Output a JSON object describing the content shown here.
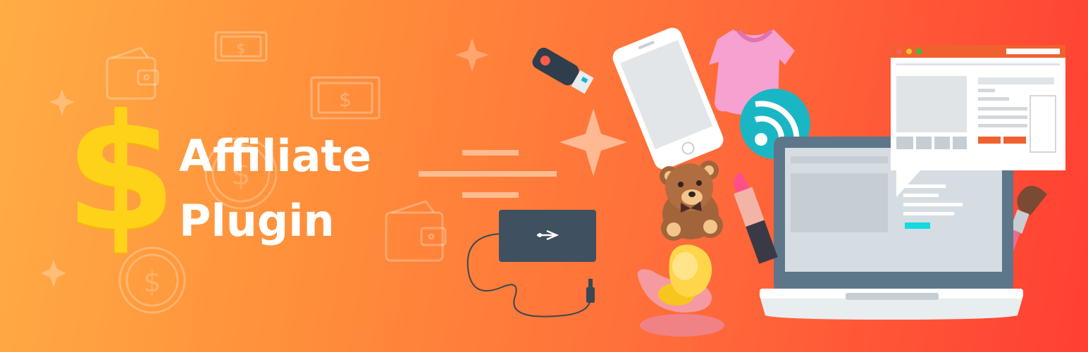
{
  "banner": {
    "title_line1": "Affiliate",
    "title_line2": "Plugin",
    "currency_symbol": "$",
    "glyphs": {
      "money": "$",
      "usb": "⭠"
    }
  },
  "colors": {
    "gradient_start": "#ffad45",
    "gradient_end": "#ff3f33",
    "dollar_yellow": "#ffd21a",
    "title_white": "#ffffff",
    "rss_teal": "#1ab6c4",
    "laptop_frame": "#5d7689",
    "bodysuit_pink": "#f6a1cf",
    "bear_brown": "#a2643a"
  },
  "icons": [
    "wallet-icon",
    "banknote-icon",
    "coin-icon",
    "sparkle-icon",
    "usb-flash-drive-icon",
    "smartphone-icon",
    "baby-bodysuit-icon",
    "rss-icon",
    "browser-window-icon",
    "laptop-icon",
    "teddy-bear-icon",
    "lipstick-icon",
    "makeup-brush-icon",
    "pacifier-icon",
    "external-hard-drive-icon",
    "usb-cable-icon"
  ]
}
